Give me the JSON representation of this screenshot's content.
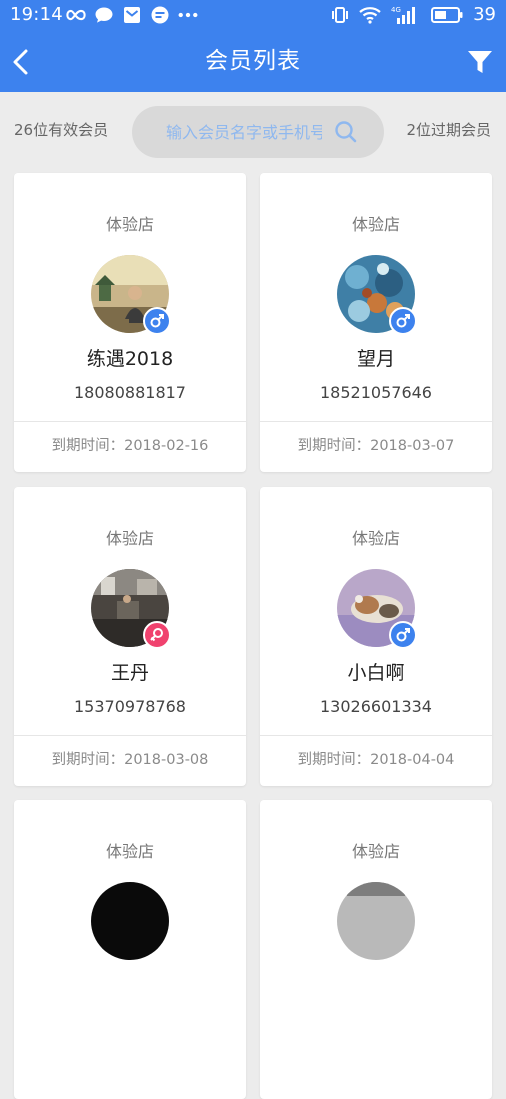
{
  "status_bar": {
    "time": "19:14",
    "battery": "39",
    "left_icons": [
      "infinity-icon",
      "chat-bubble-icon",
      "mail-icon",
      "message-icon",
      "more-dots-icon"
    ],
    "right_icons": [
      "vibrate-icon",
      "wifi-icon",
      "signal-4g-icon",
      "battery-icon"
    ]
  },
  "app_bar": {
    "title": "会员列表",
    "back_icon": "chevron-left-icon",
    "filter_icon": "filter-icon"
  },
  "summary": {
    "valid_count": "26位有效会员",
    "expired_count": "2位过期会员"
  },
  "search": {
    "placeholder": "输入会员名字或手机号"
  },
  "colors": {
    "primary": "#3d82ee",
    "male": "#3d82ee",
    "female": "#f0426e",
    "background": "#ececec"
  },
  "members": [
    {
      "store": "体验店",
      "name": "练遇2018",
      "phone": "18080881817",
      "expiry": "到期时间：2018-02-16",
      "gender": "male"
    },
    {
      "store": "体验店",
      "name": "望月",
      "phone": "18521057646",
      "expiry": "到期时间：2018-03-07",
      "gender": "male"
    },
    {
      "store": "体验店",
      "name": "王丹",
      "phone": "15370978768",
      "expiry": "到期时间：2018-03-08",
      "gender": "female"
    },
    {
      "store": "体验店",
      "name": "小白啊",
      "phone": "13026601334",
      "expiry": "到期时间：2018-04-04",
      "gender": "male"
    },
    {
      "store": "体验店"
    },
    {
      "store": "体验店"
    }
  ]
}
